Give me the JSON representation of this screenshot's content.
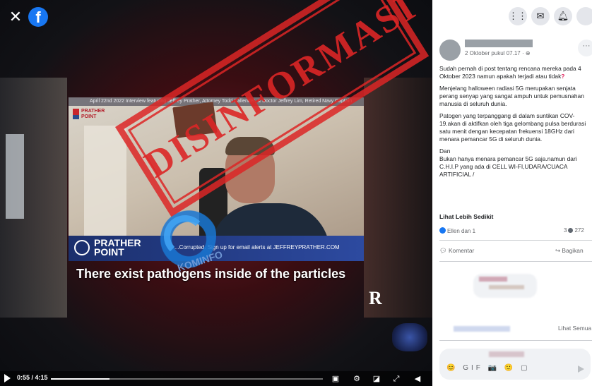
{
  "player": {
    "close_label": "✕",
    "fb_logo": "f",
    "frame_title": "April 22nd 2022 Interview featuring Jeffrey Prather, Attorney Todd Callender, & Doctor Jeffrey Lim, Retired Navy Captain",
    "frame_brand": "PRATHER POINT",
    "lower_third_brand": "PRATHER POINT",
    "lower_third_text": "...Corrupted. Sign up for email alerts at JEFFREYPRATHER.COM",
    "subtitle": "There exist pathogens inside of the particles",
    "stamp_text": "DISINFORMASI",
    "watermark_text": "KOMINFO",
    "corner_logo": "R",
    "time": "0:55 / 4:15",
    "progress": 0.216,
    "icons": [
      "play-icon",
      "captions-icon",
      "settings-icon",
      "miniplayer-icon",
      "fullscreen-icon",
      "volume-icon"
    ]
  },
  "panel": {
    "nav_icons": [
      "menu-grid-icon",
      "messenger-icon",
      "bell-icon",
      "account-icon"
    ],
    "post": {
      "date": "2 Oktober pukul 07.17 · ⊕",
      "more_label": "···",
      "paragraphs": [
        "Sudah pernah di post tentang rencana mereka pada 4 Oktober 2023 namun apakah terjadi atau tidak",
        "Menjelang halloween radiasi 5G merupakan senjata perang senyap yang sangat ampuh untuk pemusnahan manusia di seluruh dunia.",
        "Patogen yang terpanggang di dalam suntikan COV- 19.akan di aktifkan oleh tiga gelombang pulsa berdurasi satu menit dengan kecepatan frekuensi 18GHz dari menara pemancar 5G di seluruh dunia.",
        "Dan",
        "Bukan hanya menara pemancar 5G saja.namun dari C.H.I.P yang ada di CELL WI-FI,UDARA/CUACA ARTIFICIAL /"
      ],
      "question_mark": "?",
      "see_less": "Lihat Lebih Sedikit",
      "reaction_text": "Ellen dan 1",
      "stats_comments": "3",
      "stats_shares": "272",
      "action_comment": "Komentar",
      "action_share": "Bagikan",
      "see_more_comments": "Lihat Semua",
      "comment_tools": "😊 GIF 📷 🙂 ▢"
    }
  },
  "colors": {
    "accent": "#1877f2",
    "stamp": "#dc2626",
    "panel_bg": "#ffffff"
  }
}
